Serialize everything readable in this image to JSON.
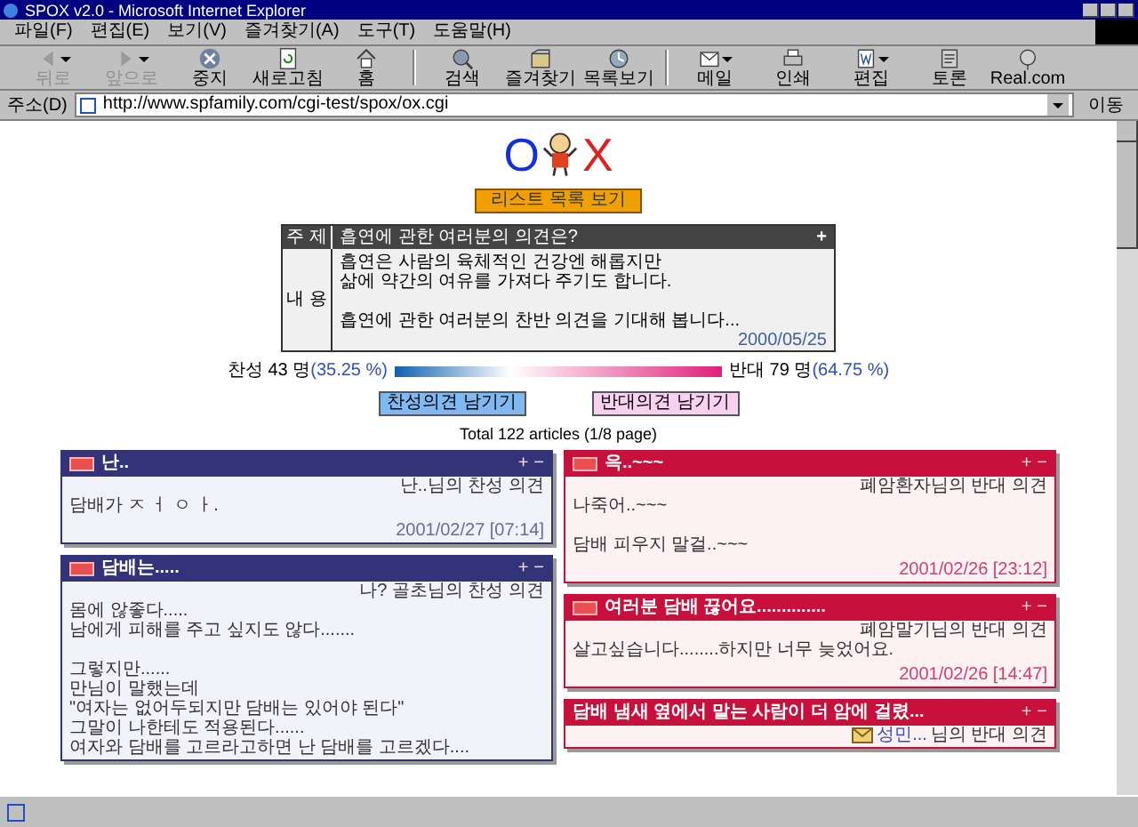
{
  "window": {
    "title": "SPOX v2.0 - Microsoft Internet Explorer"
  },
  "menu": [
    "파일(F)",
    "편집(E)",
    "보기(V)",
    "즐겨찾기(A)",
    "도구(T)",
    "도움말(H)"
  ],
  "toolbar": [
    {
      "label": "뒤로",
      "kind": "back",
      "disabled": true,
      "dropdown": true,
      "sep": false
    },
    {
      "label": "앞으로",
      "kind": "forward",
      "disabled": true,
      "dropdown": true,
      "sep": false
    },
    {
      "label": "중지",
      "kind": "stop",
      "disabled": false,
      "dropdown": false,
      "sep": false
    },
    {
      "label": "새로고침",
      "kind": "refresh",
      "disabled": false,
      "dropdown": false,
      "sep": false
    },
    {
      "label": "홈",
      "kind": "home",
      "disabled": false,
      "dropdown": false,
      "sep": true
    },
    {
      "label": "검색",
      "kind": "search",
      "disabled": false,
      "dropdown": false,
      "sep": false
    },
    {
      "label": "즐겨찾기",
      "kind": "favorites",
      "disabled": false,
      "dropdown": false,
      "sep": false
    },
    {
      "label": "목록보기",
      "kind": "history",
      "disabled": false,
      "dropdown": false,
      "sep": true
    },
    {
      "label": "메일",
      "kind": "mail",
      "disabled": false,
      "dropdown": true,
      "sep": false
    },
    {
      "label": "인쇄",
      "kind": "print",
      "disabled": false,
      "dropdown": false,
      "sep": false
    },
    {
      "label": "편집",
      "kind": "edit",
      "disabled": false,
      "dropdown": true,
      "sep": false
    },
    {
      "label": "토론",
      "kind": "discuss",
      "disabled": false,
      "dropdown": false,
      "sep": false
    },
    {
      "label": "Real.com",
      "kind": "real",
      "disabled": false,
      "dropdown": false,
      "sep": false
    }
  ],
  "address": {
    "label": "주소(D)",
    "value": "http://www.spfamily.com/cgi-test/spox/ox.cgi",
    "go": "이동"
  },
  "page": {
    "logo_o": "O",
    "logo_x": "X",
    "list_button": "리스트 목록 보기",
    "topic": {
      "subject_label": "주 제",
      "subject": "흡연에 관한 여러분의 의견은?",
      "plus": "+",
      "content_label": "내 용",
      "paragraphs": [
        [
          "흡연은 사람의 육체적인 건강엔 해롭지만",
          "삶에 약간의 여유를 가져다 주기도 합니다."
        ],
        [
          "흡연에 관한 여러분의 찬반 의견을 기대해 봅니다..."
        ]
      ],
      "date": "2000/05/25"
    },
    "vote": {
      "pro_label": "찬성 43 명",
      "pro_pct": "(35.25 %)",
      "con_label": "반대 79 명",
      "con_pct": "(64.75 %)",
      "level": 0.3525
    },
    "pro_button": "찬성의견 남기기",
    "con_button": "반대의견 남기기",
    "total": "Total 122 articles (1/8 page)",
    "columns": [
      [
        {
          "kind": "pro",
          "title": "난..",
          "new": true,
          "author": "난..님의 찬성 의견",
          "mail": false,
          "paragraphs": [
            [
              "담배가 ㅈ ㅓ ㅇ ㅏ."
            ]
          ],
          "date": "2001/02/27 [07:14]"
        },
        {
          "kind": "pro",
          "title": "담배는.....",
          "new": true,
          "author": "나? 골초님의 찬성 의견",
          "mail": false,
          "paragraphs": [
            [
              "몸에 않좋다.....",
              "남에게 피해를 주고 싶지도 않다......."
            ],
            [
              "그렇지만......",
              "만님이 말했는데",
              "\"여자는 없어두되지만 담배는 있어야 된다\"",
              "그말이 나한테도 적용된다......",
              "여자와 담배를 고르라고하면 난 담배를 고르겠다...."
            ]
          ]
        }
      ],
      [
        {
          "kind": "con",
          "title": "윽..~~~",
          "new": true,
          "author": "폐암환자님의 반대 의견",
          "mail": false,
          "paragraphs": [
            [
              "나죽어..~~~"
            ],
            [
              "담배 피우지 말걸..~~~"
            ]
          ],
          "date": "2001/02/26 [23:12]"
        },
        {
          "kind": "con",
          "title": "여러분 담배 끊어요..............",
          "new": true,
          "author": "폐암말기님의 반대 의견",
          "mail": false,
          "paragraphs": [
            [
              "살고싶습니다........하지만 너무 늦었어요."
            ]
          ],
          "date": "2001/02/26 [14:47]"
        },
        {
          "kind": "con",
          "title": "담배 냄새 옆에서 맡는 사람이 더 암에 걸렸...",
          "new": false,
          "author_link": "성민...",
          "author": "님의 반대 의견",
          "mail": true
        }
      ]
    ],
    "card_plus": "+",
    "card_minus": "−"
  }
}
